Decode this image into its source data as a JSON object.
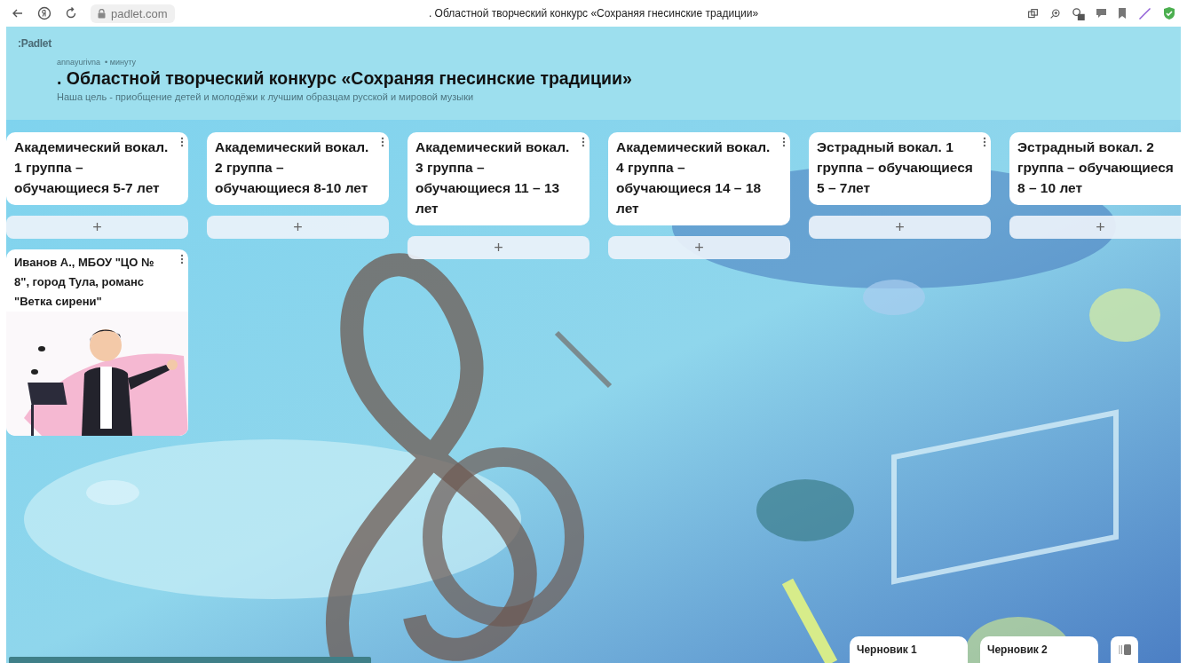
{
  "browser": {
    "url": "padlet.com",
    "tab_title": ". Областной творческий конкурс «Сохраняя гнесинские традиции»"
  },
  "header": {
    "logo": ":Padlet",
    "author": "annayurivna",
    "time": "• минуту",
    "title": ". Областной творческий конкурс «Сохраняя гнесинские традиции»",
    "description": "Наша цель - приобщение детей и молодёжи к лучшим образцам русской и мировой музыки"
  },
  "columns": [
    {
      "title": "Академический вокал. 1 группа – обучающиеся 5-7 лет",
      "add_label": "+",
      "posts": [
        {
          "title": "Иванов А., МБОУ \"ЦО № 8\", город Тула, романс \"Ветка сирени\"",
          "kind": "picture"
        }
      ]
    },
    {
      "title": "Академический вокал. 2 группа – обучающиеся 8-10 лет",
      "add_label": "+"
    },
    {
      "title": "Академический вокал. 3 группа – обучающиеся 11 – 13 лет",
      "add_label": "+"
    },
    {
      "title": "Академический вокал. 4 группа – обучающиеся 14 – 18 лет",
      "add_label": "+"
    },
    {
      "title": "Эстрадный вокал. 1 группа – обучающиеся 5 – 7лет",
      "add_label": "+"
    },
    {
      "title": "Эстрадный вокал. 2 группа – обучающиеся 8 – 10 лет",
      "add_label": "+"
    }
  ],
  "drafts": [
    {
      "label": "Черновик 1"
    },
    {
      "label": "Черновик 2"
    }
  ]
}
